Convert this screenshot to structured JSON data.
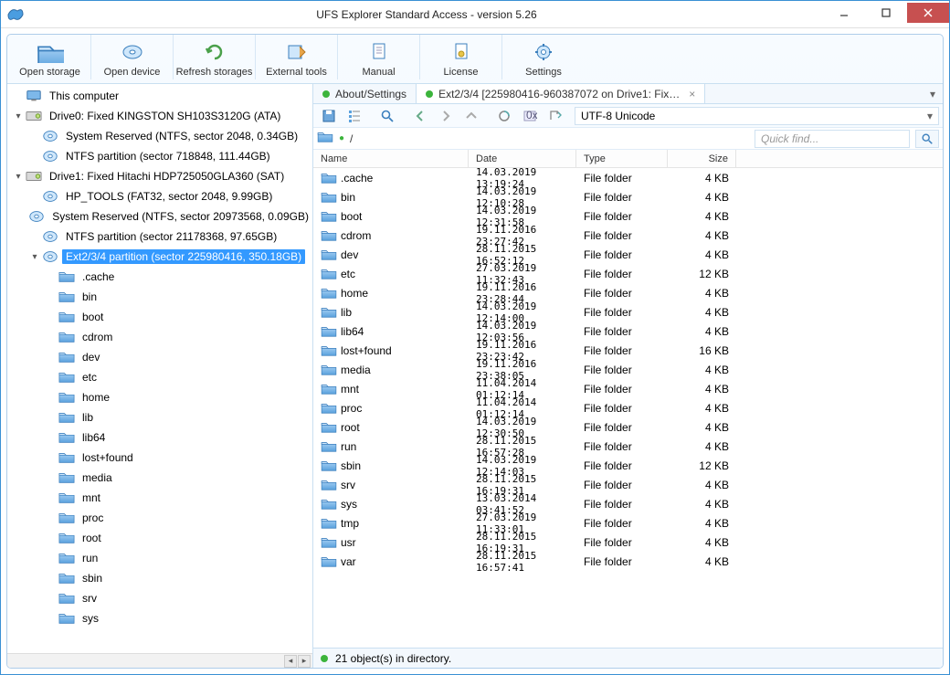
{
  "titlebar": {
    "title": "UFS Explorer Standard Access - version 5.26"
  },
  "toolbar": [
    {
      "id": "open-storage",
      "label": "Open storage"
    },
    {
      "id": "open-device",
      "label": "Open device"
    },
    {
      "id": "refresh-storages",
      "label": "Refresh storages"
    },
    {
      "id": "external-tools",
      "label": "External tools"
    },
    {
      "id": "manual",
      "label": "Manual"
    },
    {
      "id": "license",
      "label": "License"
    },
    {
      "id": "settings",
      "label": "Settings"
    }
  ],
  "tree": {
    "root": "This computer",
    "drives": [
      {
        "label": "Drive0: Fixed KINGSTON SH103S3120G (ATA)",
        "children": [
          {
            "label": "System Reserved (NTFS, sector 2048, 0.34GB)"
          },
          {
            "label": "NTFS partition (sector 718848, 111.44GB)"
          }
        ]
      },
      {
        "label": "Drive1: Fixed Hitachi HDP725050GLA360 (SAT)",
        "children": [
          {
            "label": "HP_TOOLS (FAT32, sector 2048, 9.99GB)"
          },
          {
            "label": "System Reserved (NTFS, sector 20973568, 0.09GB)"
          },
          {
            "label": "NTFS partition (sector 21178368, 97.65GB)"
          },
          {
            "label": "Ext2/3/4 partition (sector 225980416, 350.18GB)",
            "selected": true,
            "children": [
              {
                "label": ".cache"
              },
              {
                "label": "bin"
              },
              {
                "label": "boot"
              },
              {
                "label": "cdrom"
              },
              {
                "label": "dev"
              },
              {
                "label": "etc"
              },
              {
                "label": "home"
              },
              {
                "label": "lib"
              },
              {
                "label": "lib64"
              },
              {
                "label": "lost+found"
              },
              {
                "label": "media"
              },
              {
                "label": "mnt"
              },
              {
                "label": "proc"
              },
              {
                "label": "root"
              },
              {
                "label": "run"
              },
              {
                "label": "sbin"
              },
              {
                "label": "srv"
              },
              {
                "label": "sys"
              }
            ]
          }
        ]
      }
    ]
  },
  "tabs": {
    "about": "About/Settings",
    "active": "Ext2/3/4 [225980416-960387072 on Drive1: Fix…"
  },
  "encoding": "UTF-8 Unicode",
  "breadcrumb": "/",
  "quickfind_placeholder": "Quick find...",
  "columns": {
    "name": "Name",
    "date": "Date",
    "type": "Type",
    "size": "Size"
  },
  "files": [
    {
      "name": ".cache",
      "date": "14.03.2019 13:19:24",
      "type": "File folder",
      "size": "4 KB"
    },
    {
      "name": "bin",
      "date": "14.03.2019 12:10:28",
      "type": "File folder",
      "size": "4 KB"
    },
    {
      "name": "boot",
      "date": "14.03.2019 12:31:58",
      "type": "File folder",
      "size": "4 KB"
    },
    {
      "name": "cdrom",
      "date": "19.11.2016 23:27:42",
      "type": "File folder",
      "size": "4 KB"
    },
    {
      "name": "dev",
      "date": "28.11.2015 16:52:12",
      "type": "File folder",
      "size": "4 KB"
    },
    {
      "name": "etc",
      "date": "27.03.2019 11:32:43",
      "type": "File folder",
      "size": "12 KB"
    },
    {
      "name": "home",
      "date": "19.11.2016 23:28:44",
      "type": "File folder",
      "size": "4 KB"
    },
    {
      "name": "lib",
      "date": "14.03.2019 12:14:00",
      "type": "File folder",
      "size": "4 KB"
    },
    {
      "name": "lib64",
      "date": "14.03.2019 12:03:56",
      "type": "File folder",
      "size": "4 KB"
    },
    {
      "name": "lost+found",
      "date": "19.11.2016 23:23:42",
      "type": "File folder",
      "size": "16 KB"
    },
    {
      "name": "media",
      "date": "19.11.2016 23:38:05",
      "type": "File folder",
      "size": "4 KB"
    },
    {
      "name": "mnt",
      "date": "11.04.2014 01:12:14",
      "type": "File folder",
      "size": "4 KB"
    },
    {
      "name": "proc",
      "date": "11.04.2014 01:12:14",
      "type": "File folder",
      "size": "4 KB"
    },
    {
      "name": "root",
      "date": "14.03.2019 12:30:50",
      "type": "File folder",
      "size": "4 KB"
    },
    {
      "name": "run",
      "date": "28.11.2015 16:57:28",
      "type": "File folder",
      "size": "4 KB"
    },
    {
      "name": "sbin",
      "date": "14.03.2019 12:14:03",
      "type": "File folder",
      "size": "12 KB"
    },
    {
      "name": "srv",
      "date": "28.11.2015 16:19:31",
      "type": "File folder",
      "size": "4 KB"
    },
    {
      "name": "sys",
      "date": "13.03.2014 03:41:52",
      "type": "File folder",
      "size": "4 KB"
    },
    {
      "name": "tmp",
      "date": "27.03.2019 11:33:01",
      "type": "File folder",
      "size": "4 KB"
    },
    {
      "name": "usr",
      "date": "28.11.2015 16:19:31",
      "type": "File folder",
      "size": "4 KB"
    },
    {
      "name": "var",
      "date": "28.11.2015 16:57:41",
      "type": "File folder",
      "size": "4 KB"
    }
  ],
  "status": "21 object(s) in directory."
}
